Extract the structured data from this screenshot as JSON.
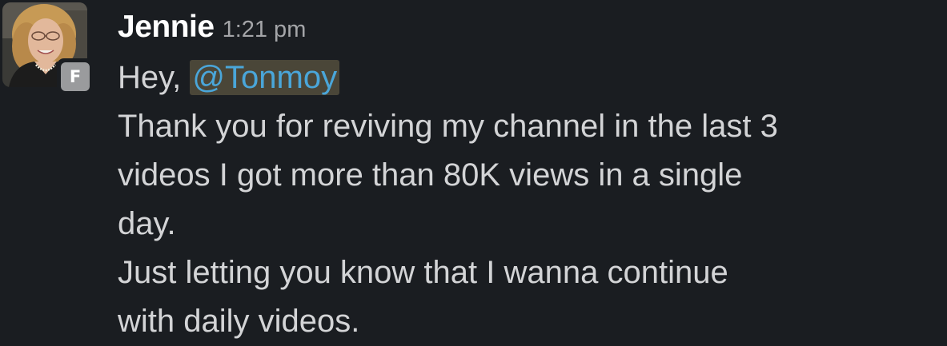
{
  "message": {
    "avatar_icon": "user-photo-avatar",
    "badge_letter": "F",
    "author": "Jennie",
    "timestamp": "1:21 pm",
    "greeting": "Hey,",
    "mention": "@Tonmoy",
    "lines": [
      "Thank you for reviving my channel in the last 3",
      "videos I got more than 80K views in a single",
      "day.",
      "Just letting you know that I wanna continue",
      "with daily videos."
    ],
    "colors": {
      "background": "#1a1d21",
      "author": "#ffffff",
      "text": "#d3d4d6",
      "timestamp": "#a4a5a8",
      "mention_text": "#4aa6d9",
      "mention_bg": "#4a4638",
      "badge_bg": "#9a9b9d"
    }
  }
}
